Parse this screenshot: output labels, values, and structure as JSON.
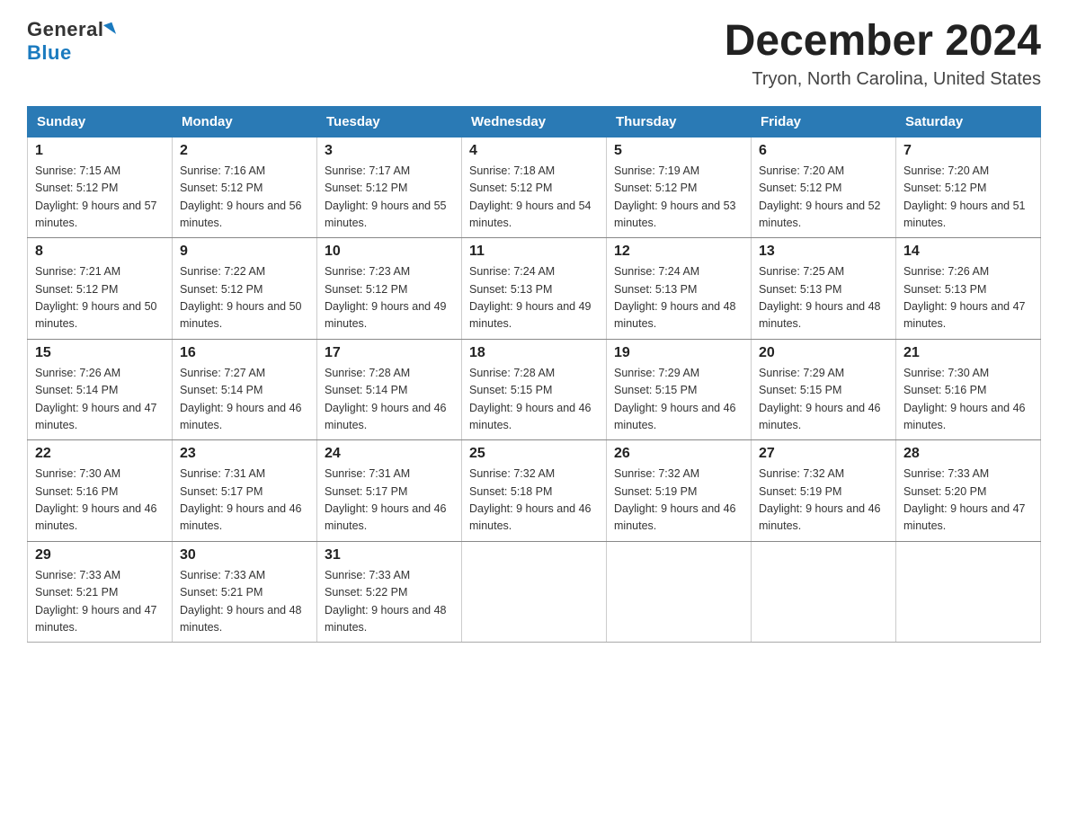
{
  "header": {
    "logo_general": "General",
    "logo_blue": "Blue",
    "month_title": "December 2024",
    "location": "Tryon, North Carolina, United States"
  },
  "days_of_week": [
    "Sunday",
    "Monday",
    "Tuesday",
    "Wednesday",
    "Thursday",
    "Friday",
    "Saturday"
  ],
  "weeks": [
    [
      {
        "day": "1",
        "sunrise": "7:15 AM",
        "sunset": "5:12 PM",
        "daylight": "9 hours and 57 minutes."
      },
      {
        "day": "2",
        "sunrise": "7:16 AM",
        "sunset": "5:12 PM",
        "daylight": "9 hours and 56 minutes."
      },
      {
        "day": "3",
        "sunrise": "7:17 AM",
        "sunset": "5:12 PM",
        "daylight": "9 hours and 55 minutes."
      },
      {
        "day": "4",
        "sunrise": "7:18 AM",
        "sunset": "5:12 PM",
        "daylight": "9 hours and 54 minutes."
      },
      {
        "day": "5",
        "sunrise": "7:19 AM",
        "sunset": "5:12 PM",
        "daylight": "9 hours and 53 minutes."
      },
      {
        "day": "6",
        "sunrise": "7:20 AM",
        "sunset": "5:12 PM",
        "daylight": "9 hours and 52 minutes."
      },
      {
        "day": "7",
        "sunrise": "7:20 AM",
        "sunset": "5:12 PM",
        "daylight": "9 hours and 51 minutes."
      }
    ],
    [
      {
        "day": "8",
        "sunrise": "7:21 AM",
        "sunset": "5:12 PM",
        "daylight": "9 hours and 50 minutes."
      },
      {
        "day": "9",
        "sunrise": "7:22 AM",
        "sunset": "5:12 PM",
        "daylight": "9 hours and 50 minutes."
      },
      {
        "day": "10",
        "sunrise": "7:23 AM",
        "sunset": "5:12 PM",
        "daylight": "9 hours and 49 minutes."
      },
      {
        "day": "11",
        "sunrise": "7:24 AM",
        "sunset": "5:13 PM",
        "daylight": "9 hours and 49 minutes."
      },
      {
        "day": "12",
        "sunrise": "7:24 AM",
        "sunset": "5:13 PM",
        "daylight": "9 hours and 48 minutes."
      },
      {
        "day": "13",
        "sunrise": "7:25 AM",
        "sunset": "5:13 PM",
        "daylight": "9 hours and 48 minutes."
      },
      {
        "day": "14",
        "sunrise": "7:26 AM",
        "sunset": "5:13 PM",
        "daylight": "9 hours and 47 minutes."
      }
    ],
    [
      {
        "day": "15",
        "sunrise": "7:26 AM",
        "sunset": "5:14 PM",
        "daylight": "9 hours and 47 minutes."
      },
      {
        "day": "16",
        "sunrise": "7:27 AM",
        "sunset": "5:14 PM",
        "daylight": "9 hours and 46 minutes."
      },
      {
        "day": "17",
        "sunrise": "7:28 AM",
        "sunset": "5:14 PM",
        "daylight": "9 hours and 46 minutes."
      },
      {
        "day": "18",
        "sunrise": "7:28 AM",
        "sunset": "5:15 PM",
        "daylight": "9 hours and 46 minutes."
      },
      {
        "day": "19",
        "sunrise": "7:29 AM",
        "sunset": "5:15 PM",
        "daylight": "9 hours and 46 minutes."
      },
      {
        "day": "20",
        "sunrise": "7:29 AM",
        "sunset": "5:15 PM",
        "daylight": "9 hours and 46 minutes."
      },
      {
        "day": "21",
        "sunrise": "7:30 AM",
        "sunset": "5:16 PM",
        "daylight": "9 hours and 46 minutes."
      }
    ],
    [
      {
        "day": "22",
        "sunrise": "7:30 AM",
        "sunset": "5:16 PM",
        "daylight": "9 hours and 46 minutes."
      },
      {
        "day": "23",
        "sunrise": "7:31 AM",
        "sunset": "5:17 PM",
        "daylight": "9 hours and 46 minutes."
      },
      {
        "day": "24",
        "sunrise": "7:31 AM",
        "sunset": "5:17 PM",
        "daylight": "9 hours and 46 minutes."
      },
      {
        "day": "25",
        "sunrise": "7:32 AM",
        "sunset": "5:18 PM",
        "daylight": "9 hours and 46 minutes."
      },
      {
        "day": "26",
        "sunrise": "7:32 AM",
        "sunset": "5:19 PM",
        "daylight": "9 hours and 46 minutes."
      },
      {
        "day": "27",
        "sunrise": "7:32 AM",
        "sunset": "5:19 PM",
        "daylight": "9 hours and 46 minutes."
      },
      {
        "day": "28",
        "sunrise": "7:33 AM",
        "sunset": "5:20 PM",
        "daylight": "9 hours and 47 minutes."
      }
    ],
    [
      {
        "day": "29",
        "sunrise": "7:33 AM",
        "sunset": "5:21 PM",
        "daylight": "9 hours and 47 minutes."
      },
      {
        "day": "30",
        "sunrise": "7:33 AM",
        "sunset": "5:21 PM",
        "daylight": "9 hours and 48 minutes."
      },
      {
        "day": "31",
        "sunrise": "7:33 AM",
        "sunset": "5:22 PM",
        "daylight": "9 hours and 48 minutes."
      },
      null,
      null,
      null,
      null
    ]
  ]
}
